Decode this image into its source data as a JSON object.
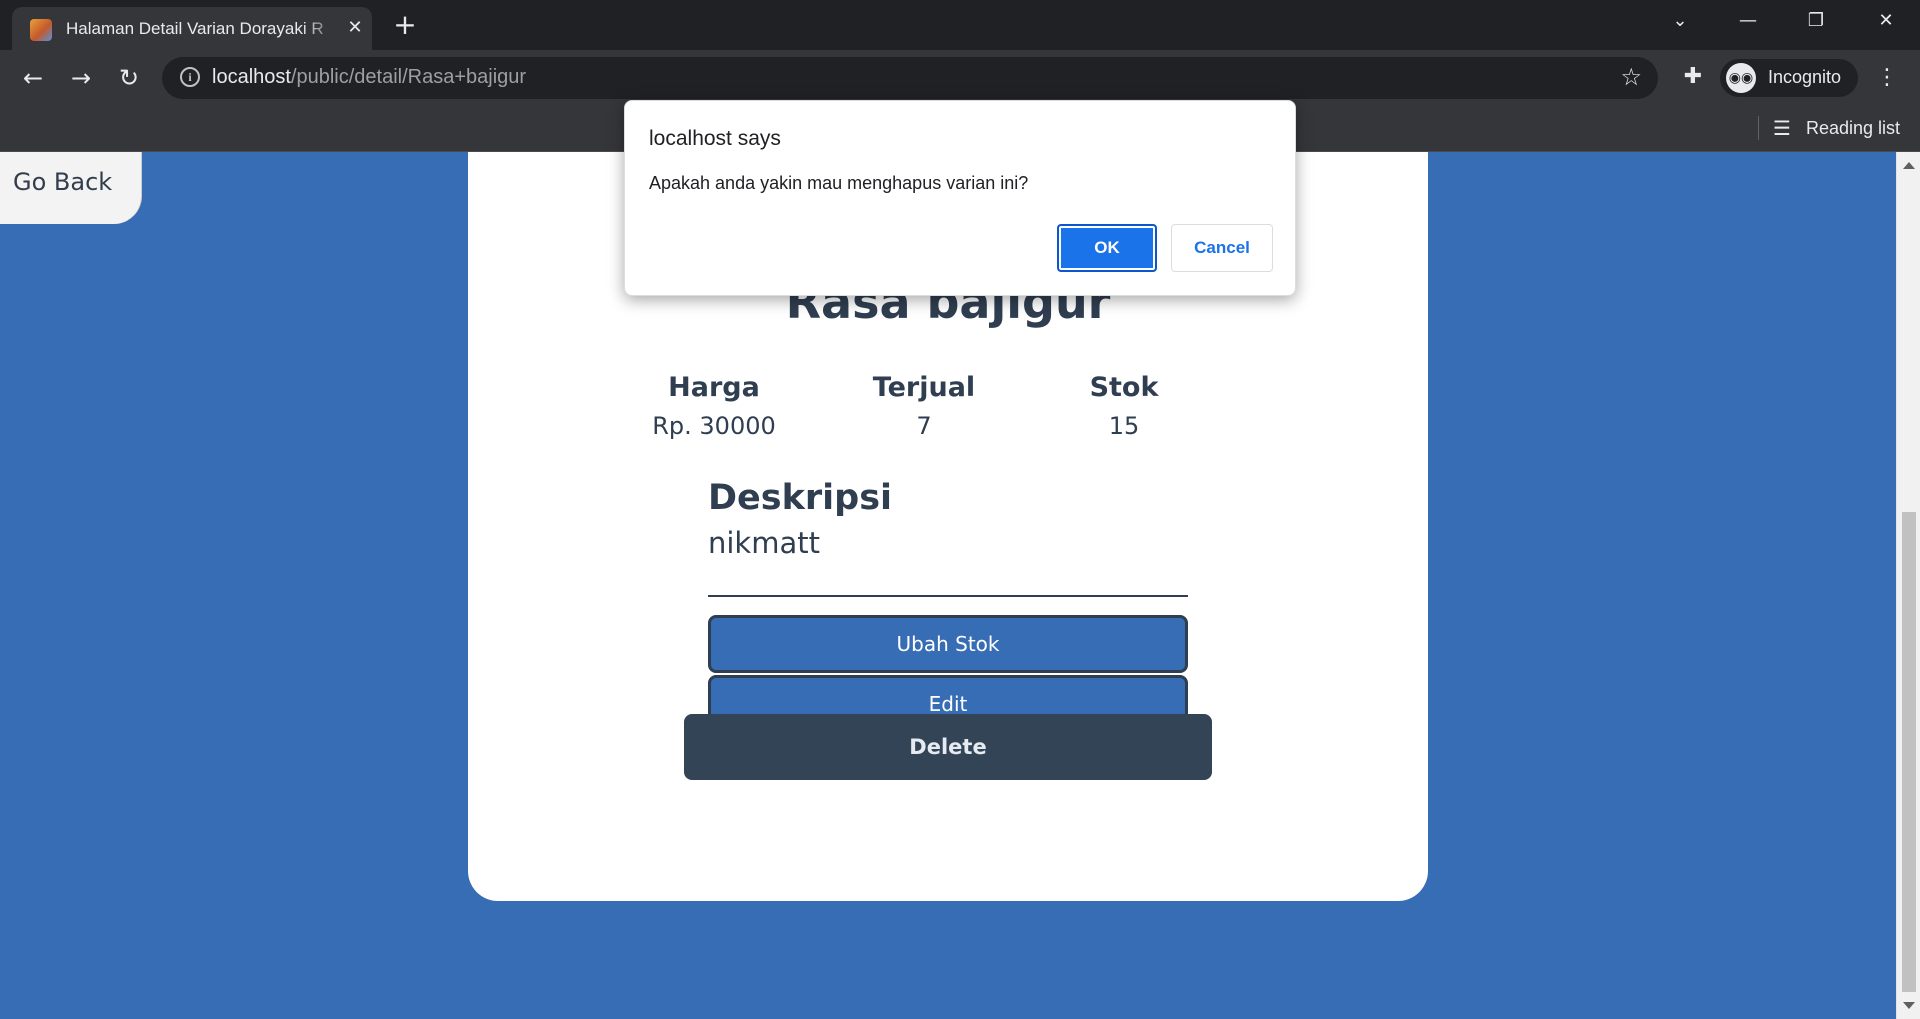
{
  "browser": {
    "tab_title": "Halaman Detail Varian Dorayaki R",
    "tab_close_icon": "close-icon",
    "new_tab_label": "+",
    "url_host": "localhost",
    "url_path": "/public/detail/Rasa+bajigur",
    "incognito_label": "Incognito",
    "reading_list_label": "Reading list",
    "window_controls": {
      "tabsearch": "⌄",
      "minimize": "—",
      "restore": "❐",
      "close": "✕"
    },
    "nav": {
      "back": "←",
      "forward": "→",
      "reload": "↻"
    }
  },
  "page": {
    "go_back_label": "Go Back",
    "variant_name": "Rasa bajigur",
    "stats": [
      {
        "label": "Harga",
        "value": "Rp. 30000"
      },
      {
        "label": "Terjual",
        "value": "7"
      },
      {
        "label": "Stok",
        "value": "15"
      }
    ],
    "description_title": "Deskripsi",
    "description_text": "nikmatt",
    "buttons": {
      "ubah_stok": "Ubah Stok",
      "edit": "Edit",
      "delete": "Delete"
    }
  },
  "dialog": {
    "title": "localhost says",
    "message": "Apakah anda yakin mau menghapus varian ini?",
    "ok_label": "OK",
    "cancel_label": "Cancel"
  },
  "colors": {
    "page_background": "#376db5",
    "primary_text": "#2f3e50",
    "delete_button": "#334456",
    "dialog_ok": "#1a73e8"
  }
}
